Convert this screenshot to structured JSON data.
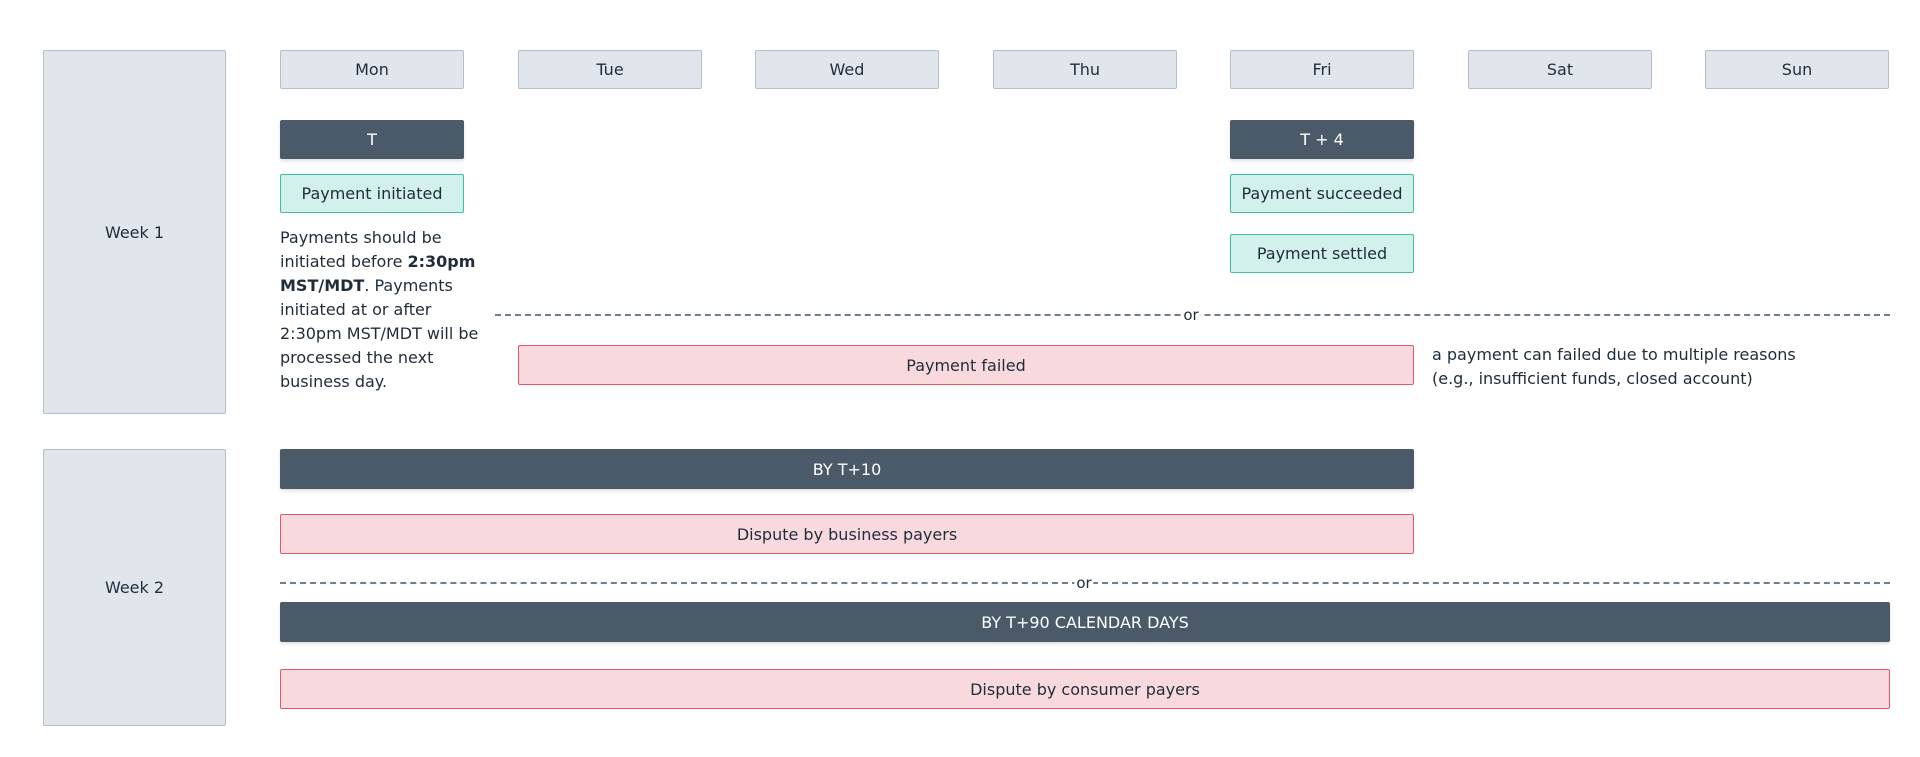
{
  "weeks": [
    "Week 1",
    "Week 2"
  ],
  "days": [
    "Mon",
    "Tue",
    "Wed",
    "Thu",
    "Fri",
    "Sat",
    "Sun"
  ],
  "week1": {
    "t_label": "T",
    "t4_label": "T + 4",
    "payment_initiated": "Payment initiated",
    "payment_succeeded": "Payment succeeded",
    "payment_settled": "Payment settled",
    "note_part1": "Payments should be initiated before ",
    "note_bold": "2:30pm MST/MDT",
    "note_part2": ". Payments initiated at or after 2:30pm MST/MDT will be processed the next business day.",
    "or_label": "or",
    "payment_failed": "Payment failed",
    "failed_note_line1": "a payment can failed due to multiple reasons",
    "failed_note_line2": "(e.g., insufficient funds, closed account)"
  },
  "week2": {
    "by_t10": "BY T+10",
    "dispute_business": "Dispute by business payers",
    "or_label": "or",
    "by_t90": "BY T+90 CALENDAR DAYS",
    "dispute_consumer": "Dispute by consumer payers"
  },
  "colors": {
    "header_fill": "#e1e6ed",
    "milestone_dark": "#4a5a69",
    "success_fill": "#d2f0ec",
    "success_border": "#3dbfa7",
    "failure_fill": "#f7d9de",
    "failure_border": "#e4566c"
  }
}
